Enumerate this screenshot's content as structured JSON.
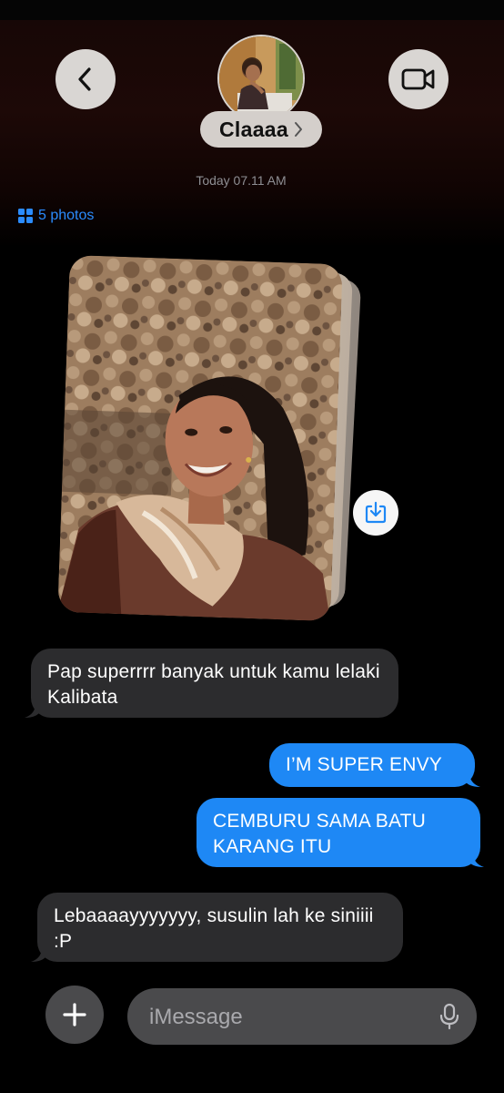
{
  "header": {
    "back_label": "back",
    "contact_name": "Claaaa",
    "video_label": "FaceTime video"
  },
  "thread": {
    "timestamp": "Today 07.11 AM",
    "photos_link": "5 photos"
  },
  "messages": [
    {
      "direction": "incoming",
      "text": "Pap superrrr banyak untuk kamu lelaki Kalibata"
    },
    {
      "direction": "outgoing",
      "text": "I’M SUPER ENVY"
    },
    {
      "direction": "outgoing",
      "text": "CEMBURU SAMA BATU KARANG ITU"
    },
    {
      "direction": "incoming",
      "text": "Lebaaaayyyyyyy, susulin lah ke siniiii :P"
    }
  ],
  "compose": {
    "placeholder": "iMessage"
  },
  "icons": {
    "back": "chevron-left-icon",
    "video": "video-camera-icon",
    "disclosure": "chevron-right-icon",
    "photos": "grid-icon",
    "save": "download-icon",
    "add": "plus-icon",
    "mic": "microphone-icon"
  },
  "colors": {
    "outgoing_bubble": "#1e88f5",
    "incoming_bubble": "#2c2c2e",
    "link": "#2b8cff",
    "header_glow": "#1d0907"
  }
}
